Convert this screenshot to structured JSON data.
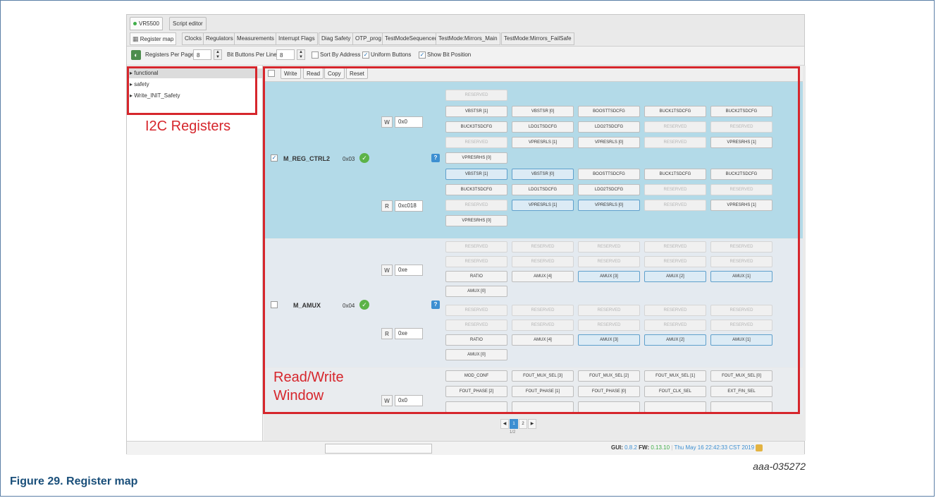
{
  "app_tabs": [
    {
      "label": "VR5500",
      "active": true,
      "status_color": "#3fae49"
    },
    {
      "label": "Script editor",
      "active": false
    }
  ],
  "view_tabs": [
    "Register map",
    "Clocks",
    "Regulators",
    "Measurements",
    "Interrupt Flags",
    "Diag Safety",
    "OTP_prog",
    "TestModeSequencer",
    "TestMode:Mirrors_Main",
    "TestMode:Mirrors_FailSafe"
  ],
  "view_tab_icon": "grid-icon",
  "toolbar": {
    "registers_per_page_label": "Registers Per Page",
    "registers_per_page_value": "8",
    "bit_buttons_label": "Bit Buttons Per Line",
    "bit_buttons_value": "8",
    "sort_by_address": "Sort By Address",
    "uniform_buttons": "Uniform Buttons",
    "show_bit_position": "Show Bit Position"
  },
  "tree": [
    "functional",
    "safety",
    "Write_INIT_Safety"
  ],
  "rw_toolbar": {
    "write": "Write",
    "read": "Read",
    "copy": "Copy",
    "reset": "Reset"
  },
  "registers": [
    {
      "name": "M_REG_CTRL2",
      "address": "0x03",
      "write_label": "W",
      "write_value": "0x0",
      "read_label": "R",
      "read_value": "0xc018",
      "write_bits": {
        "r0": [
          "RESERVED"
        ],
        "r1": [
          "VBSTSR [1]",
          "VBSTSR [0]",
          "BOOSTTSDCFG",
          "BUCK1TSDCFG",
          "BUCK2TSDCFG"
        ],
        "r2": [
          "BUCK3TSDCFG",
          "LDO1TSDCFG",
          "LDO2TSDCFG",
          "RESERVED",
          "RESERVED"
        ],
        "r3": [
          "RESERVED",
          "VPRESRLS [1]",
          "VPRESRLS [0]",
          "RESERVED",
          "VPRESRHS [1]"
        ],
        "r4": [
          "VPRESRHS [0]"
        ]
      },
      "read_bits": {
        "r1": [
          "VBSTSR [1]",
          "VBSTSR [0]",
          "BOOSTTSDCFG",
          "BUCK1TSDCFG",
          "BUCK2TSDCFG"
        ],
        "r2": [
          "BUCK3TSDCFG",
          "LDO1TSDCFG",
          "LDO2TSDCFG",
          "RESERVED",
          "RESERVED"
        ],
        "r3": [
          "RESERVED",
          "VPRESRLS [1]",
          "VPRESRLS [0]",
          "RESERVED",
          "VPRESRHS [1]"
        ],
        "r4": [
          "VPRESRHS [0]"
        ]
      }
    },
    {
      "name": "M_AMUX",
      "address": "0x04",
      "write_label": "W",
      "write_value": "0xe",
      "read_label": "R",
      "read_value": "0xe",
      "write_bits": {
        "r1": [
          "RESERVED",
          "RESERVED",
          "RESERVED",
          "RESERVED",
          "RESERVED"
        ],
        "r2": [
          "RESERVED",
          "RESERVED",
          "RESERVED",
          "RESERVED",
          "RESERVED"
        ],
        "r3": [
          "RATIO",
          "AMUX [4]",
          "AMUX [3]",
          "AMUX [2]",
          "AMUX [1]"
        ],
        "r4": [
          "AMUX [0]"
        ]
      },
      "read_bits": {
        "r1": [
          "RESERVED",
          "RESERVED",
          "RESERVED",
          "RESERVED",
          "RESERVED"
        ],
        "r2": [
          "RESERVED",
          "RESERVED",
          "RESERVED",
          "RESERVED",
          "RESERVED"
        ],
        "r3": [
          "RATIO",
          "AMUX [4]",
          "AMUX [3]",
          "AMUX [2]",
          "AMUX [1]"
        ],
        "r4": [
          "AMUX [0]"
        ]
      }
    },
    {
      "write_label": "W",
      "write_value": "0x0",
      "write_bits": {
        "r1": [
          "MOD_CONF",
          "FOUT_MUX_SEL [3]",
          "FOUT_MUX_SEL [2]",
          "FOUT_MUX_SEL [1]",
          "FOUT_MUX_SEL [0]"
        ],
        "r2": [
          "FOUT_PHASE [2]",
          "FOUT_PHASE [1]",
          "FOUT_PHASE [0]",
          "FOUT_CLK_SEL",
          "EXT_FIN_SEL"
        ]
      }
    }
  ],
  "pager": {
    "pages": [
      "1",
      "2"
    ],
    "current": "1",
    "label": "1/2"
  },
  "status": {
    "gui_label": "GUI:",
    "gui_version": "0.8.2",
    "fw_label": "FW:",
    "fw_version": "0.13.10",
    "datetime": "Thu May 16 22:42:33 CST 2019"
  },
  "annotations": {
    "i2c": "I2C Registers",
    "rw_window": "Read/Write\nWindow",
    "color": "#d6262c"
  },
  "figure_id": "aaa-035272",
  "caption": "Figure 29.  Register map"
}
